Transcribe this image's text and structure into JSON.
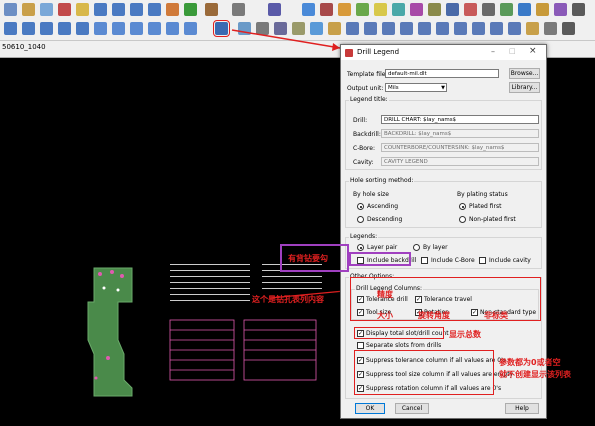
{
  "tab": {
    "label": "50610_1040"
  },
  "dialog": {
    "title": "Drill Legend",
    "template_label": "Template file:",
    "template_value": "default-mil.dlt",
    "browse_label": "Browse...",
    "output_unit_label": "Output unit:",
    "output_unit_value": "Mils",
    "library_label": "Library...",
    "legend_title": {
      "group": "Legend title:",
      "drill_label": "Drill:",
      "drill_value": "DRILL CHART: $lay_nams$",
      "backdrill_label": "Backdrill:",
      "backdrill_value": "BACKDRILL: $lay_nams$",
      "cbore_label": "C-Bore:",
      "cbore_value": "COUNTERBORE/COUNTERSINK: $lay_nams$",
      "cavity_label": "Cavity:",
      "cavity_value": "CAVITY LEGEND"
    },
    "sorting": {
      "group": "Hole sorting method:",
      "by_size": "By hole size",
      "ascending": "Ascending",
      "descending": "Descending",
      "by_plating": "By plating status",
      "plated_first": "Plated first",
      "non_plated_first": "Non-plated first"
    },
    "legends": {
      "group": "Legends:",
      "layer_pair": "Layer pair",
      "by_layer": "By layer",
      "include_backdrill": "Include backdrill",
      "include_cbore": "Include C-Bore",
      "include_cavity": "Include cavity"
    },
    "other": {
      "group": "Other Options:",
      "columns_group": "Drill Legend Columns:",
      "tolerance_drill": "Tolerance drill",
      "tolerance_travel": "Tolerance travel",
      "tool_size": "Tool size",
      "rotation": "Rotation",
      "non_standard": "Non-standard type",
      "display_total": "Display total slot/drill count",
      "separate_slots": "Separate slots from drills",
      "suppress_tolerance": "Suppress tolerance column if all values are 0's",
      "suppress_tool_size": "Suppress tool size column if all values are empty",
      "suppress_rotation": "Suppress rotation column if all values are 0's"
    },
    "ok_label": "OK",
    "cancel_label": "Cancel",
    "help_label": "Help"
  },
  "annotations": {
    "backdrill": "有背钻要勾",
    "table_content": "这个是钻孔表列内容",
    "precision": "精度",
    "size": "大小",
    "rotation_angle": "旋转角度",
    "nonstandard": "非标类",
    "display_total": "显示总数",
    "suppress_note_1": "参数都为0或者空",
    "suppress_note_2": "就不创建显示该列表"
  },
  "colors": {
    "accent_red": "#e02020",
    "annotation_purple": "#a040c0",
    "board_green": "#4a8a4a"
  }
}
